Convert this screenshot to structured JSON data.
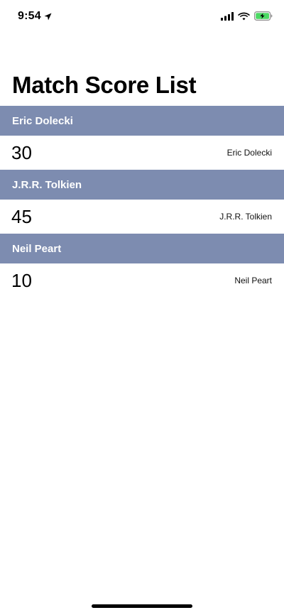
{
  "status_bar": {
    "time": "9:54",
    "icons": [
      "location-arrow-icon",
      "cellular-signal-icon",
      "wifi-icon",
      "battery-charging-icon"
    ],
    "battery_color": "#4cd964"
  },
  "title": "Match Score List",
  "colors": {
    "section_header_bg": "#7d8cb0",
    "section_header_text": "#ffffff"
  },
  "entries": [
    {
      "header": "Eric Dolecki",
      "score": "30",
      "name": "Eric Dolecki"
    },
    {
      "header": "J.R.R. Tolkien",
      "score": "45",
      "name": "J.R.R. Tolkien"
    },
    {
      "header": "Neil Peart",
      "score": "10",
      "name": "Neil Peart"
    }
  ]
}
